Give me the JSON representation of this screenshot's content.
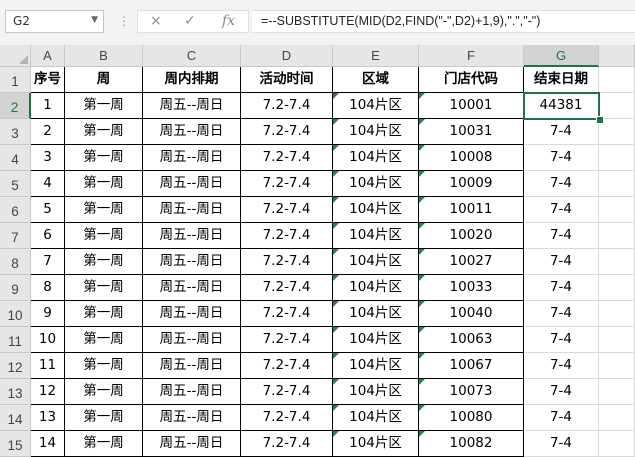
{
  "formula_bar": {
    "name_box": "G2",
    "formula": "=--SUBSTITUTE(MID(D2,FIND(\"-\",D2)+1,9),\".\",\"-\")",
    "cancel_icon": "×",
    "enter_icon": "✓",
    "fx_icon": "fx"
  },
  "sheet": {
    "columns": [
      "A",
      "B",
      "C",
      "D",
      "E",
      "F",
      "G"
    ],
    "active_column": "G",
    "active_row": 2,
    "headers": [
      "序号",
      "周",
      "周内排期",
      "活动时间",
      "区域",
      "门店代码",
      "结束日期"
    ],
    "rows": [
      [
        "1",
        "第一周",
        "周五--周日",
        "7.2-7.4",
        "104片区",
        "10001",
        "44381"
      ],
      [
        "2",
        "第一周",
        "周五--周日",
        "7.2-7.4",
        "104片区",
        "10031",
        "7-4"
      ],
      [
        "3",
        "第一周",
        "周五--周日",
        "7.2-7.4",
        "104片区",
        "10008",
        "7-4"
      ],
      [
        "4",
        "第一周",
        "周五--周日",
        "7.2-7.4",
        "104片区",
        "10009",
        "7-4"
      ],
      [
        "5",
        "第一周",
        "周五--周日",
        "7.2-7.4",
        "104片区",
        "10011",
        "7-4"
      ],
      [
        "6",
        "第一周",
        "周五--周日",
        "7.2-7.4",
        "104片区",
        "10020",
        "7-4"
      ],
      [
        "7",
        "第一周",
        "周五--周日",
        "7.2-7.4",
        "104片区",
        "10027",
        "7-4"
      ],
      [
        "8",
        "第一周",
        "周五--周日",
        "7.2-7.4",
        "104片区",
        "10033",
        "7-4"
      ],
      [
        "9",
        "第一周",
        "周五--周日",
        "7.2-7.4",
        "104片区",
        "10040",
        "7-4"
      ],
      [
        "10",
        "第一周",
        "周五--周日",
        "7.2-7.4",
        "104片区",
        "10063",
        "7-4"
      ],
      [
        "11",
        "第一周",
        "周五--周日",
        "7.2-7.4",
        "104片区",
        "10067",
        "7-4"
      ],
      [
        "12",
        "第一周",
        "周五--周日",
        "7.2-7.4",
        "104片区",
        "10073",
        "7-4"
      ],
      [
        "13",
        "第一周",
        "周五--周日",
        "7.2-7.4",
        "104片区",
        "10080",
        "7-4"
      ],
      [
        "14",
        "第一周",
        "周五--周日",
        "7.2-7.4",
        "104片区",
        "10082",
        "7-4"
      ]
    ]
  }
}
